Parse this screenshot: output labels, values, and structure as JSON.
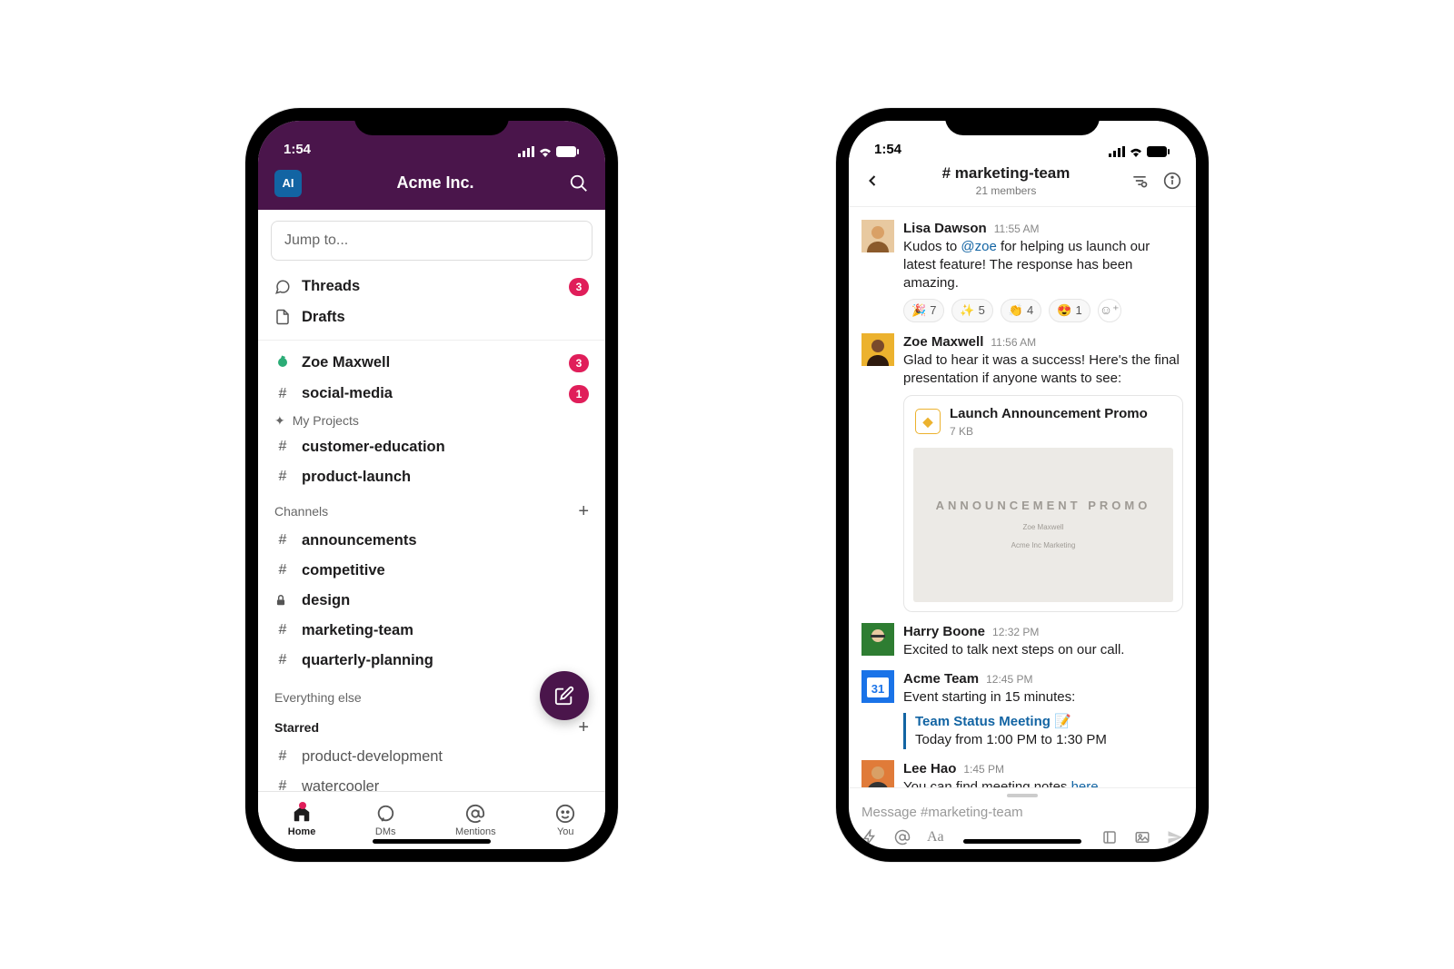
{
  "status": {
    "time": "1:54"
  },
  "left": {
    "workspace_initials": "AI",
    "workspace_name": "Acme Inc.",
    "jump_placeholder": "Jump to...",
    "threads_label": "Threads",
    "threads_count": "3",
    "drafts_label": "Drafts",
    "unreads": [
      {
        "icon": "presence",
        "label": "Zoe Maxwell",
        "count": "3"
      },
      {
        "icon": "hash",
        "label": "social-media",
        "count": "1"
      }
    ],
    "my_projects_label": "My Projects",
    "my_projects": [
      {
        "label": "customer-education"
      },
      {
        "label": "product-launch"
      }
    ],
    "channels_label": "Channels",
    "channels": [
      {
        "icon": "hash",
        "label": "announcements"
      },
      {
        "icon": "hash",
        "label": "competitive"
      },
      {
        "icon": "lock",
        "label": "design"
      },
      {
        "icon": "hash",
        "label": "marketing-team"
      },
      {
        "icon": "hash",
        "label": "quarterly-planning"
      }
    ],
    "everything_else_label": "Everything else",
    "starred_label": "Starred",
    "starred": [
      {
        "label": "product-development"
      },
      {
        "label": "watercooler"
      }
    ],
    "tabs": {
      "home": "Home",
      "dms": "DMs",
      "mentions": "Mentions",
      "you": "You"
    }
  },
  "right": {
    "channel_name": "# marketing-team",
    "members": "21 members",
    "messages": {
      "m0": {
        "name": "Lisa Dawson",
        "time": "11:55 AM",
        "pre": "Kudos to ",
        "mention": "@zoe",
        "post": " for helping us launch our latest feature! The response has been amazing.",
        "reactions": [
          {
            "emoji": "🎉",
            "count": "7"
          },
          {
            "emoji": "✨",
            "count": "5"
          },
          {
            "emoji": "👏",
            "count": "4"
          },
          {
            "emoji": "😍",
            "count": "1"
          }
        ]
      },
      "m1": {
        "name": "Zoe Maxwell",
        "time": "11:56 AM",
        "text": "Glad to hear it was a success! Here's the final presentation if anyone wants to see:",
        "attachment": {
          "title": "Launch Announcement Promo",
          "size": "7 KB",
          "preview_big": "ANNOUNCEMENT PROMO",
          "preview_l1": "Zoe Maxwell",
          "preview_l2": "Acme Inc Marketing"
        }
      },
      "m2": {
        "name": "Harry Boone",
        "time": "12:32 PM",
        "text": "Excited to talk next steps on our call."
      },
      "m3": {
        "name": "Acme Team",
        "time": "12:45 PM",
        "text": "Event starting in 15 minutes:",
        "event_title": "Team Status Meeting 📝",
        "event_when": "Today from 1:00 PM to 1:30 PM"
      },
      "m4": {
        "name": "Lee Hao",
        "time": "1:45 PM",
        "pre": "You can find meeting notes ",
        "link": "here",
        "post": "."
      }
    },
    "composer_placeholder": "Message #marketing-team"
  }
}
